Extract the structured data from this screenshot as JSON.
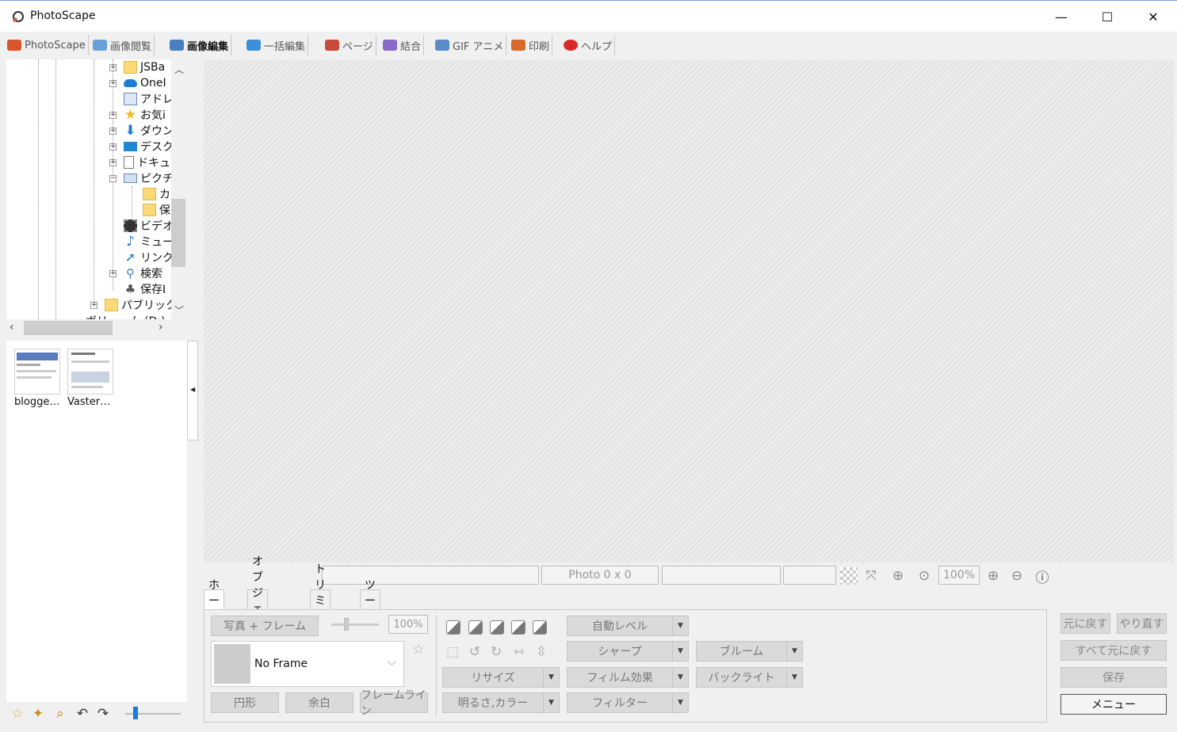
{
  "window": {
    "title": "PhotoScape",
    "minimize": "—",
    "maximize": "☐",
    "close": "✕"
  },
  "main_tabs": [
    {
      "label": "PhotoScape",
      "color": "#d9542b"
    },
    {
      "label": "画像閲覧",
      "color": "#6aa0d8"
    },
    {
      "label": "画像編集",
      "color": "#4a7fc1"
    },
    {
      "label": "一括編集",
      "color": "#3d8fd8"
    },
    {
      "label": "ページ",
      "color": "#c84a3a"
    },
    {
      "label": "結合",
      "color": "#8a6ac8"
    },
    {
      "label": "GIF アニメ",
      "color": "#5a8ac8"
    },
    {
      "label": "印刷",
      "color": "#d86a2a"
    },
    {
      "label": "ヘルプ",
      "color": "#d82a2a"
    }
  ],
  "tree": {
    "items": [
      {
        "label": "JSBa",
        "icon": "folder-icon"
      },
      {
        "label": "OneI",
        "icon": "onedrive-icon"
      },
      {
        "label": "アドレ",
        "icon": "contacts-icon"
      },
      {
        "label": "お気i",
        "icon": "star-icon"
      },
      {
        "label": "ダウン",
        "icon": "download-icon"
      },
      {
        "label": "デスク",
        "icon": "desktop-icon"
      },
      {
        "label": "ドキュ",
        "icon": "document-icon"
      },
      {
        "label": "ピクチ",
        "icon": "pictures-icon"
      },
      {
        "label": "カ",
        "icon": "folder-icon"
      },
      {
        "label": "保",
        "icon": "folder-icon"
      },
      {
        "label": "ビデオ",
        "icon": "video-icon"
      },
      {
        "label": "ミュー",
        "icon": "music-icon"
      },
      {
        "label": "リンク",
        "icon": "link-icon"
      },
      {
        "label": "検索",
        "icon": "search-icon"
      },
      {
        "label": "保存I",
        "icon": "saved-games-icon"
      },
      {
        "label": "パブリック",
        "icon": "folder-icon"
      },
      {
        "label": "ボリューム (D:)",
        "icon": "drive-icon"
      }
    ]
  },
  "thumbnails": [
    {
      "label": "blogge…"
    },
    {
      "label": "Vaster…"
    }
  ],
  "status": {
    "photo_size": "Photo 0 x 0",
    "zoom": "100%"
  },
  "edit_tabs": [
    "ホーム",
    "オブジェクト",
    "トリミング",
    "ツール"
  ],
  "home": {
    "photo_frame": "写真 + フレーム",
    "frame_percent": "100%",
    "frame_name": "No Frame",
    "circle": "円形",
    "margin": "余白",
    "frame_line": "フレームライン",
    "resize": "リサイズ",
    "brightness_color": "明るさ,カラー",
    "auto_level": "自動レベル",
    "sharpen": "シャープ",
    "film_effect": "フィルム効果",
    "filter": "フィルター",
    "bloom": "ブルーム",
    "backlight": "バックライト"
  },
  "right": {
    "undo": "元に戻す",
    "redo": "やり直す",
    "undo_all": "すべて元に戻す",
    "save": "保存",
    "menu": "メニュー"
  }
}
